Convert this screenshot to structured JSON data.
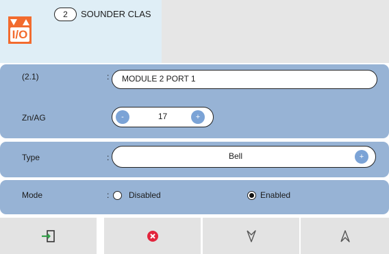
{
  "header": {
    "zone_number": "2",
    "zone_title": "SOUNDER CLAS",
    "icon": "io-module-icon",
    "icon_text": "I/O"
  },
  "address": {
    "label": "(2.1)",
    "colon": ":",
    "value": "MODULE 2 PORT 1"
  },
  "zone": {
    "label": "Zn/AG",
    "value": "17",
    "minus": "-",
    "plus": "+"
  },
  "type": {
    "label": "Type",
    "colon": ":",
    "value": "Bell",
    "plus": "+"
  },
  "mode": {
    "label": "Mode",
    "colon": ":",
    "options": [
      {
        "label": "Disabled",
        "selected": false
      },
      {
        "label": "Enabled",
        "selected": true
      }
    ]
  },
  "toolbar": {
    "buttons": [
      {
        "icon": "exit-icon"
      },
      {
        "icon": "cancel-icon"
      },
      {
        "icon": "down-arrow-icon"
      },
      {
        "icon": "up-arrow-icon"
      }
    ]
  },
  "colors": {
    "accent_orange": "#f26b2e",
    "panel_blue": "#97b3d5",
    "button_blue": "#7ba3d6",
    "header_left": "#dfeef6",
    "header_right": "#e6e6e6",
    "toolbar_gray": "#e3e3e3",
    "cancel_red": "#e2253d",
    "exit_green": "#33a24a"
  }
}
